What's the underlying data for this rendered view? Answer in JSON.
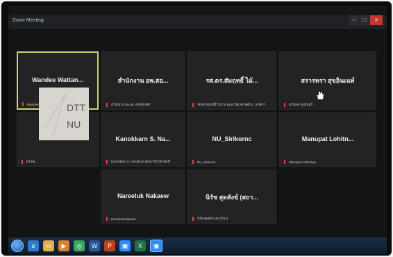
{
  "window": {
    "title": "Zoom Meeting"
  },
  "controls": {
    "minimize": "–",
    "maximize": "□",
    "close": "×"
  },
  "participants": [
    {
      "name": "Wandee Wattan...",
      "label": "Wandee Wattanachaiyingcharoen",
      "active": true
    },
    {
      "name": "สำนักงาน อพ.สอ...",
      "label": "สำนักงาน อพ.สอ. สกลนิเทศก์"
    },
    {
      "name": "รศ.ดร.สัมฤทธิ์ ไม้...",
      "label": "รศ.ดร.สัมฤทธิ์ ไม้งาม คณะวิทยาศาสตร์ ม. นเรศวร"
    },
    {
      "name": "สรารทรา สุขอินเนท์",
      "label": "อรรถพร สุขอินทร์"
    },
    {
      "name": "",
      "label": "ดร.ดล...",
      "logo": "DTT NU"
    },
    {
      "name": "Kanokkarn S. Na...",
      "label": "Kanokkarn S. Nanakool (คณะวิทยาศาสตร์)"
    },
    {
      "name": "NU_Sirikornc",
      "label": "NU_Sirikornc"
    },
    {
      "name": "Manupat Lohitn...",
      "label": "Manupat Lohitnawy"
    },
    {
      "name": "Nareeluk Nakaew",
      "label": "Nareeluk Nakaew"
    },
    {
      "name": "นิรัช สุดสังข์ (สถา...",
      "label": "นิรัช สุดสังข์ (สถาบันฯ)"
    }
  ],
  "logo": {
    "line1": "DTT",
    "line2": "NU"
  },
  "taskbar": {
    "icons": [
      "ie-icon",
      "explorer-icon",
      "media-icon",
      "chrome-icon",
      "word-icon",
      "powerpoint-icon",
      "zoom-icon",
      "excel-icon",
      "zoom-app-icon"
    ]
  }
}
